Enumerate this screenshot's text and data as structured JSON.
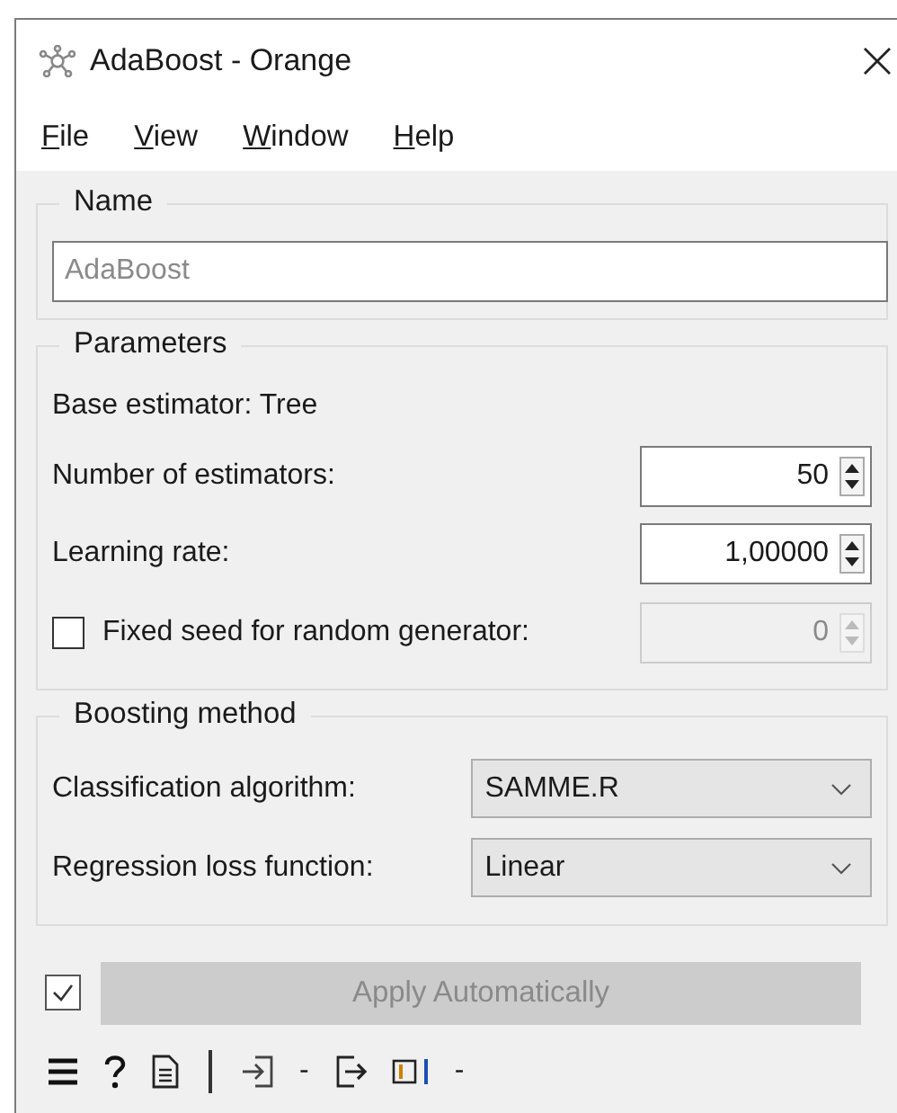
{
  "window": {
    "title": "AdaBoost - Orange"
  },
  "menu": [
    "File",
    "View",
    "Window",
    "Help"
  ],
  "name_box": {
    "title": "Name",
    "placeholder": "AdaBoost"
  },
  "parameters": {
    "title": "Parameters",
    "base_estimator": "Base estimator: Tree",
    "rows": [
      {
        "kind": "spin",
        "label": "Number of estimators:",
        "value": "50",
        "disabled": false
      },
      {
        "kind": "spin",
        "label": "Learning rate:",
        "value": "1,00000",
        "disabled": false
      },
      {
        "kind": "check_spin",
        "label": "Fixed seed for random generator:",
        "checked": false,
        "value": "0",
        "disabled": true
      }
    ]
  },
  "boosting": {
    "title": "Boosting method",
    "rows": [
      {
        "label": "Classification algorithm:",
        "value": "SAMME.R"
      },
      {
        "label": "Regression loss function:",
        "value": "Linear"
      }
    ]
  },
  "apply": {
    "checked": true,
    "label": "Apply Automatically",
    "disabled": true
  },
  "status_bar": {
    "input_summary": "-",
    "output_summary": "-"
  }
}
